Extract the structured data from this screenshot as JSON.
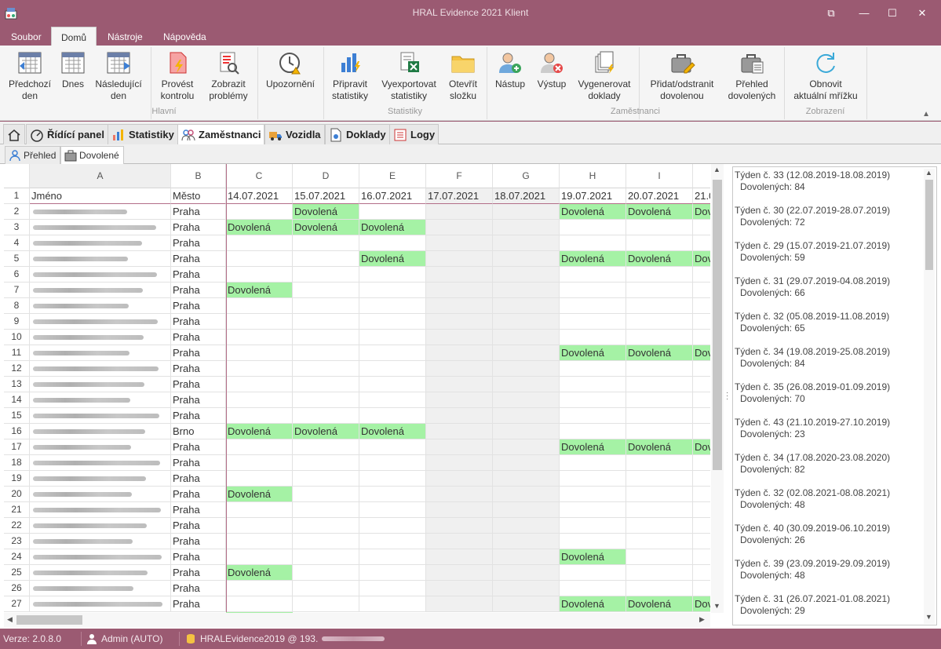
{
  "window": {
    "title": "HRAL Evidence 2021 Klient",
    "controls": [
      "⧉",
      "—",
      "☐",
      "✕"
    ]
  },
  "menu": [
    "Soubor",
    "Domů",
    "Nástroje",
    "Nápověda"
  ],
  "ribbon": {
    "buttons": [
      {
        "label": "Předchozí\nden",
        "icon": "calendar-prev-icon"
      },
      {
        "label": "Dnes",
        "icon": "calendar-today-icon"
      },
      {
        "label": "Následující\nden",
        "icon": "calendar-next-icon"
      },
      {
        "label": "Provést\nkontrolu",
        "icon": "check-document-icon"
      },
      {
        "label": "Zobrazit\nproblémy",
        "icon": "problems-icon"
      },
      {
        "label": "Upozornění",
        "icon": "alarm-clock-icon"
      },
      {
        "label": "Připravit\nstatistiky",
        "icon": "bar-chart-icon"
      },
      {
        "label": "Vyexportovat\nstatistiky",
        "icon": "excel-export-icon"
      },
      {
        "label": "Otevřít\nsložku",
        "icon": "folder-icon"
      },
      {
        "label": "Nástup",
        "icon": "user-add-icon"
      },
      {
        "label": "Výstup",
        "icon": "user-remove-icon"
      },
      {
        "label": "Vygenerovat\ndoklady",
        "icon": "documents-icon"
      },
      {
        "label": "Přidat/odstranit\ndovolenou",
        "icon": "suitcase-edit-icon"
      },
      {
        "label": "Přehled\ndovolených",
        "icon": "suitcase-list-icon"
      },
      {
        "label": "Obnovit\naktuální mřížku",
        "icon": "refresh-icon"
      }
    ],
    "groups": [
      "Hlavní",
      "Statistiky",
      "Zaměstnanci",
      "Zobrazení"
    ]
  },
  "tabs": [
    "Řídící panel",
    "Statistiky",
    "Zaměstnanci",
    "Vozidla",
    "Doklady",
    "Logy"
  ],
  "active_tab": "Zaměstnanci",
  "subtabs": [
    "Přehled",
    "Dovolené"
  ],
  "active_subtab": "Dovolené",
  "grid": {
    "columns": [
      "A",
      "B",
      "C",
      "D",
      "E",
      "F",
      "G",
      "H",
      "I",
      ""
    ],
    "header_row": [
      "Jméno",
      "Město",
      "14.07.2021",
      "15.07.2021",
      "16.07.2021",
      "17.07.2021",
      "18.07.2021",
      "19.07.2021",
      "20.07.2021",
      "21.0"
    ],
    "vacation_label": "Dovolená",
    "cut_label": "Dov",
    "rows": [
      {
        "n": "2",
        "city": "Praha",
        "vac": [
          1,
          5,
          6,
          7
        ]
      },
      {
        "n": "3",
        "city": "Praha",
        "vac": [
          0,
          1,
          2
        ]
      },
      {
        "n": "4",
        "city": "Praha",
        "vac": []
      },
      {
        "n": "5",
        "city": "Praha",
        "vac": [
          2,
          5,
          6,
          7
        ]
      },
      {
        "n": "6",
        "city": "Praha",
        "vac": []
      },
      {
        "n": "7",
        "city": "Praha",
        "vac": [
          0
        ]
      },
      {
        "n": "8",
        "city": "Praha",
        "vac": []
      },
      {
        "n": "9",
        "city": "Praha",
        "vac": []
      },
      {
        "n": "10",
        "city": "Praha",
        "vac": []
      },
      {
        "n": "11",
        "city": "Praha",
        "vac": [
          5,
          6,
          7
        ]
      },
      {
        "n": "12",
        "city": "Praha",
        "vac": []
      },
      {
        "n": "13",
        "city": "Praha",
        "vac": []
      },
      {
        "n": "14",
        "city": "Praha",
        "vac": []
      },
      {
        "n": "15",
        "city": "Praha",
        "vac": []
      },
      {
        "n": "16",
        "city": "Brno",
        "vac": [
          0,
          1,
          2
        ]
      },
      {
        "n": "17",
        "city": "Praha",
        "vac": [
          5,
          6,
          7
        ]
      },
      {
        "n": "18",
        "city": "Praha",
        "vac": []
      },
      {
        "n": "19",
        "city": "Praha",
        "vac": []
      },
      {
        "n": "20",
        "city": "Praha",
        "vac": [
          0
        ]
      },
      {
        "n": "21",
        "city": "Praha",
        "vac": []
      },
      {
        "n": "22",
        "city": "Praha",
        "vac": []
      },
      {
        "n": "23",
        "city": "Praha",
        "vac": []
      },
      {
        "n": "24",
        "city": "Praha",
        "vac": [
          5
        ]
      },
      {
        "n": "25",
        "city": "Praha",
        "vac": [
          0
        ]
      },
      {
        "n": "26",
        "city": "Praha",
        "vac": []
      },
      {
        "n": "27",
        "city": "Praha",
        "vac": [
          5,
          6,
          7
        ]
      }
    ]
  },
  "weeks_panel": [
    {
      "week": "Týden č. 33 (12.08.2019-18.08.2019)",
      "count": "Dovolených: 84"
    },
    {
      "week": "Týden č. 30 (22.07.2019-28.07.2019)",
      "count": "Dovolených: 72"
    },
    {
      "week": "Týden č. 29 (15.07.2019-21.07.2019)",
      "count": "Dovolených: 59"
    },
    {
      "week": "Týden č. 31 (29.07.2019-04.08.2019)",
      "count": "Dovolených: 66"
    },
    {
      "week": "Týden č. 32 (05.08.2019-11.08.2019)",
      "count": "Dovolených: 65"
    },
    {
      "week": "Týden č. 34 (19.08.2019-25.08.2019)",
      "count": "Dovolených: 84"
    },
    {
      "week": "Týden č. 35 (26.08.2019-01.09.2019)",
      "count": "Dovolených: 70"
    },
    {
      "week": "Týden č. 43 (21.10.2019-27.10.2019)",
      "count": "Dovolených: 23"
    },
    {
      "week": "Týden č. 34 (17.08.2020-23.08.2020)",
      "count": "Dovolených: 82"
    },
    {
      "week": "Týden č. 32 (02.08.2021-08.08.2021)",
      "count": "Dovolených: 48"
    },
    {
      "week": "Týden č. 40 (30.09.2019-06.10.2019)",
      "count": "Dovolených: 26"
    },
    {
      "week": "Týden č. 39 (23.09.2019-29.09.2019)",
      "count": "Dovolených: 48"
    },
    {
      "week": "Týden č. 31 (26.07.2021-01.08.2021)",
      "count": "Dovolených: 29"
    }
  ],
  "status": {
    "version": "Verze: 2.0.8.0",
    "user": "Admin (AUTO)",
    "db": "HRALEvidence2019 @ 193."
  },
  "colors": {
    "accent": "#9b5a72",
    "vacation": "#a5f2a5",
    "weekend": "#f0f0f0"
  }
}
